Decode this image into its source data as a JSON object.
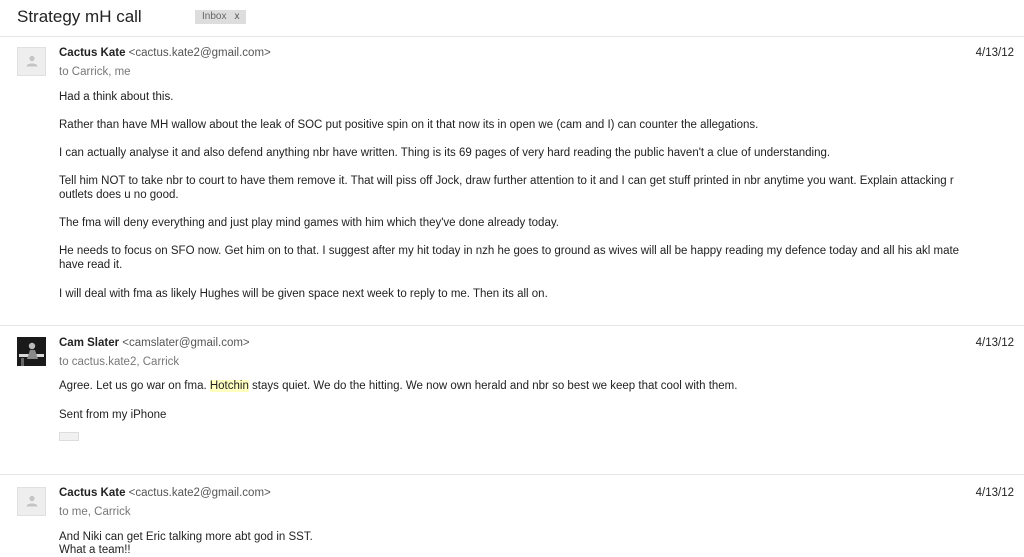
{
  "thread": {
    "subject": "Strategy mH call",
    "label": "Inbox",
    "label_remove": "x"
  },
  "messages": [
    {
      "sender_name": "Cactus Kate",
      "sender_email": "<cactus.kate2@gmail.com>",
      "to": "to Carrick, me",
      "date": "4/13/12",
      "avatar_icon": "default-person-icon",
      "paragraphs": [
        "Had a think about this.",
        "Rather than have MH wallow about the leak of SOC put positive spin on it that now its in open we (cam and I) can counter the allegations.",
        "I can actually analyse it and also defend anything nbr have written. Thing is its 69 pages of very hard reading the public haven't a clue of understanding.",
        "Tell him NOT to take nbr to court to have them remove it. That will piss off Jock, draw further attention to it and I can get stuff printed in nbr anytime you want. Explain attacking r",
        "outlets does u no good.",
        "The fma will deny everything and just play mind games with him which they've done already today.",
        "He needs to focus on SFO now. Get him on to that. I suggest after my hit today in nzh he goes to ground as wives will all be happy reading my defence today and all his akl mate",
        "have read it.",
        "I will deal with fma as likely Hughes will be given space next week to reply to me. Then its all on."
      ]
    },
    {
      "sender_name": "Cam Slater",
      "sender_email": "<camslater@gmail.com>",
      "to": "to cactus.kate2, Carrick",
      "date": "4/13/12",
      "avatar_icon": "profile-photo",
      "body_before": "Agree. Let us go war on fma. ",
      "body_highlight": "Hotchin",
      "body_after": " stays quiet. We do the hitting. We now own herald and nbr so best we keep that cool with them.",
      "signature": "Sent from my iPhone"
    },
    {
      "sender_name": "Cactus Kate",
      "sender_email": "<cactus.kate2@gmail.com>",
      "to": "to me, Carrick",
      "date": "4/13/12",
      "avatar_icon": "default-person-icon",
      "paragraphs": [
        "And Niki can get Eric talking more abt god in SST.",
        "What a team!!"
      ]
    }
  ]
}
